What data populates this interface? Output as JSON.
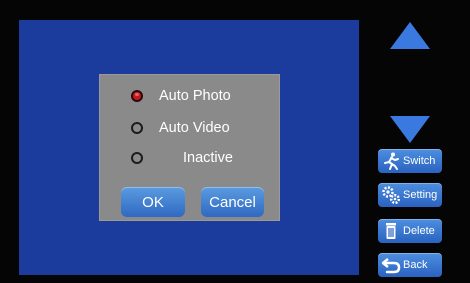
{
  "dialog": {
    "options": [
      {
        "label": "Auto Photo",
        "selected": true
      },
      {
        "label": "Auto Video",
        "selected": false
      },
      {
        "label": "Inactive",
        "selected": false
      }
    ],
    "ok_label": "OK",
    "cancel_label": "Cancel"
  },
  "side_buttons": {
    "switch_label": "Switch",
    "setting_label": "Setting",
    "delete_label": "Delete",
    "back_label": "Back"
  },
  "icons": {
    "scroll_up": "arrow-up-icon",
    "scroll_down": "arrow-down-icon",
    "switch": "running-person-icon",
    "setting": "gears-icon",
    "delete": "trash-icon",
    "back": "return-arrow-icon"
  },
  "colors": {
    "screen_bg": "#1b3c9c",
    "dialog_bg": "#8a8a8a",
    "button_blue": "#3a7ae0",
    "radio_selected": "#c8181e"
  }
}
